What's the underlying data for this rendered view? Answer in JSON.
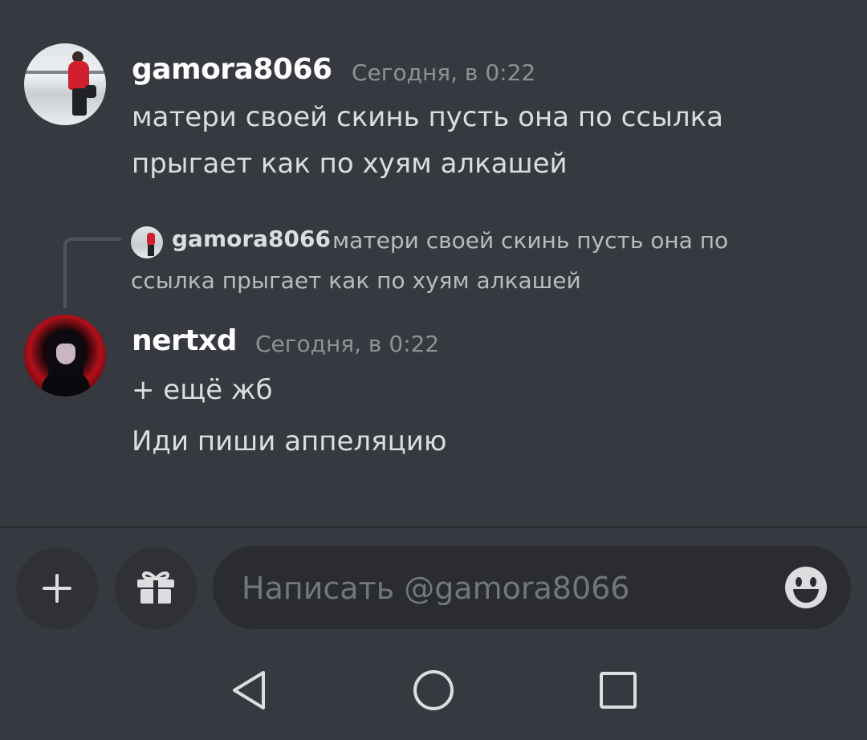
{
  "messages": [
    {
      "username": "gamora8066",
      "timestamp": "Сегодня, в 0:22",
      "lines": [
        "матери своей скинь пусть она по ссылка",
        "прыгает как по хуям алкашей"
      ]
    },
    {
      "reply": {
        "username": "gamora8066",
        "text_line1": "матери своей скинь пусть она по",
        "text_line2": "ссылка прыгает как по хуям алкашей"
      },
      "username": "nertxd",
      "timestamp": "Сегодня, в 0:22",
      "lines": [
        "+ ещё жб",
        "Иди пиши аппеляцию"
      ]
    }
  ],
  "composer": {
    "placeholder": "Написать @gamora8066",
    "icons": [
      "plus-icon",
      "gift-icon",
      "emoji-icon"
    ]
  },
  "system_nav": {
    "icons": [
      "back-icon",
      "home-icon",
      "recents-icon"
    ]
  },
  "colors": {
    "background": "#36393f",
    "input_background": "#2a2c31",
    "username": "#ffffff",
    "timestamp": "#8e9297",
    "text": "#dcddde",
    "placeholder": "#72767d"
  }
}
